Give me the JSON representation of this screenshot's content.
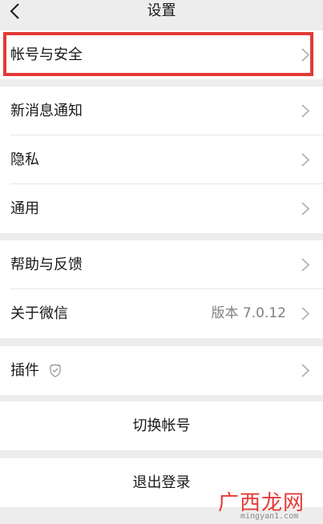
{
  "navbar": {
    "title": "设置"
  },
  "group1": {
    "items": [
      {
        "label": "帐号与安全"
      }
    ]
  },
  "group2": {
    "items": [
      {
        "label": "新消息通知"
      },
      {
        "label": "隐私"
      },
      {
        "label": "通用"
      }
    ]
  },
  "group3": {
    "items": [
      {
        "label": "帮助与反馈"
      },
      {
        "label": "关于微信",
        "value": "版本 7.0.12"
      }
    ]
  },
  "group4": {
    "items": [
      {
        "label": "插件"
      }
    ]
  },
  "actions": {
    "switch_account": "切换帐号",
    "logout": "退出登录"
  },
  "watermark": {
    "brand": "广西龙网",
    "url": "mingyan1.com"
  },
  "colors": {
    "highlight": "#e53935",
    "background": "#ededed"
  }
}
